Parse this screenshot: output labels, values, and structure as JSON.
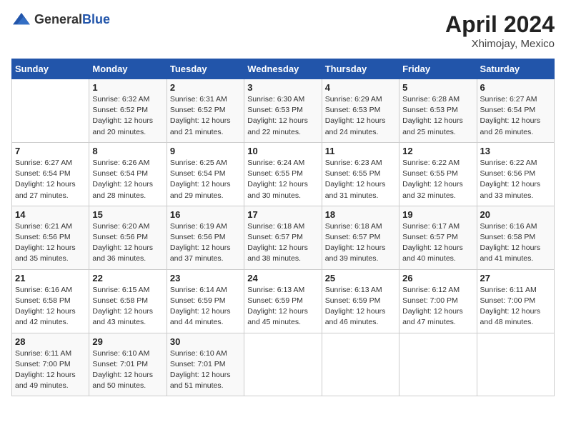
{
  "header": {
    "logo_general": "General",
    "logo_blue": "Blue",
    "month_year": "April 2024",
    "location": "Xhimojay, Mexico"
  },
  "days_of_week": [
    "Sunday",
    "Monday",
    "Tuesday",
    "Wednesday",
    "Thursday",
    "Friday",
    "Saturday"
  ],
  "weeks": [
    [
      {
        "day": "",
        "info": ""
      },
      {
        "day": "1",
        "info": "Sunrise: 6:32 AM\nSunset: 6:52 PM\nDaylight: 12 hours\nand 20 minutes."
      },
      {
        "day": "2",
        "info": "Sunrise: 6:31 AM\nSunset: 6:52 PM\nDaylight: 12 hours\nand 21 minutes."
      },
      {
        "day": "3",
        "info": "Sunrise: 6:30 AM\nSunset: 6:53 PM\nDaylight: 12 hours\nand 22 minutes."
      },
      {
        "day": "4",
        "info": "Sunrise: 6:29 AM\nSunset: 6:53 PM\nDaylight: 12 hours\nand 24 minutes."
      },
      {
        "day": "5",
        "info": "Sunrise: 6:28 AM\nSunset: 6:53 PM\nDaylight: 12 hours\nand 25 minutes."
      },
      {
        "day": "6",
        "info": "Sunrise: 6:27 AM\nSunset: 6:54 PM\nDaylight: 12 hours\nand 26 minutes."
      }
    ],
    [
      {
        "day": "7",
        "info": "Sunrise: 6:27 AM\nSunset: 6:54 PM\nDaylight: 12 hours\nand 27 minutes."
      },
      {
        "day": "8",
        "info": "Sunrise: 6:26 AM\nSunset: 6:54 PM\nDaylight: 12 hours\nand 28 minutes."
      },
      {
        "day": "9",
        "info": "Sunrise: 6:25 AM\nSunset: 6:54 PM\nDaylight: 12 hours\nand 29 minutes."
      },
      {
        "day": "10",
        "info": "Sunrise: 6:24 AM\nSunset: 6:55 PM\nDaylight: 12 hours\nand 30 minutes."
      },
      {
        "day": "11",
        "info": "Sunrise: 6:23 AM\nSunset: 6:55 PM\nDaylight: 12 hours\nand 31 minutes."
      },
      {
        "day": "12",
        "info": "Sunrise: 6:22 AM\nSunset: 6:55 PM\nDaylight: 12 hours\nand 32 minutes."
      },
      {
        "day": "13",
        "info": "Sunrise: 6:22 AM\nSunset: 6:56 PM\nDaylight: 12 hours\nand 33 minutes."
      }
    ],
    [
      {
        "day": "14",
        "info": "Sunrise: 6:21 AM\nSunset: 6:56 PM\nDaylight: 12 hours\nand 35 minutes."
      },
      {
        "day": "15",
        "info": "Sunrise: 6:20 AM\nSunset: 6:56 PM\nDaylight: 12 hours\nand 36 minutes."
      },
      {
        "day": "16",
        "info": "Sunrise: 6:19 AM\nSunset: 6:56 PM\nDaylight: 12 hours\nand 37 minutes."
      },
      {
        "day": "17",
        "info": "Sunrise: 6:18 AM\nSunset: 6:57 PM\nDaylight: 12 hours\nand 38 minutes."
      },
      {
        "day": "18",
        "info": "Sunrise: 6:18 AM\nSunset: 6:57 PM\nDaylight: 12 hours\nand 39 minutes."
      },
      {
        "day": "19",
        "info": "Sunrise: 6:17 AM\nSunset: 6:57 PM\nDaylight: 12 hours\nand 40 minutes."
      },
      {
        "day": "20",
        "info": "Sunrise: 6:16 AM\nSunset: 6:58 PM\nDaylight: 12 hours\nand 41 minutes."
      }
    ],
    [
      {
        "day": "21",
        "info": "Sunrise: 6:16 AM\nSunset: 6:58 PM\nDaylight: 12 hours\nand 42 minutes."
      },
      {
        "day": "22",
        "info": "Sunrise: 6:15 AM\nSunset: 6:58 PM\nDaylight: 12 hours\nand 43 minutes."
      },
      {
        "day": "23",
        "info": "Sunrise: 6:14 AM\nSunset: 6:59 PM\nDaylight: 12 hours\nand 44 minutes."
      },
      {
        "day": "24",
        "info": "Sunrise: 6:13 AM\nSunset: 6:59 PM\nDaylight: 12 hours\nand 45 minutes."
      },
      {
        "day": "25",
        "info": "Sunrise: 6:13 AM\nSunset: 6:59 PM\nDaylight: 12 hours\nand 46 minutes."
      },
      {
        "day": "26",
        "info": "Sunrise: 6:12 AM\nSunset: 7:00 PM\nDaylight: 12 hours\nand 47 minutes."
      },
      {
        "day": "27",
        "info": "Sunrise: 6:11 AM\nSunset: 7:00 PM\nDaylight: 12 hours\nand 48 minutes."
      }
    ],
    [
      {
        "day": "28",
        "info": "Sunrise: 6:11 AM\nSunset: 7:00 PM\nDaylight: 12 hours\nand 49 minutes."
      },
      {
        "day": "29",
        "info": "Sunrise: 6:10 AM\nSunset: 7:01 PM\nDaylight: 12 hours\nand 50 minutes."
      },
      {
        "day": "30",
        "info": "Sunrise: 6:10 AM\nSunset: 7:01 PM\nDaylight: 12 hours\nand 51 minutes."
      },
      {
        "day": "",
        "info": ""
      },
      {
        "day": "",
        "info": ""
      },
      {
        "day": "",
        "info": ""
      },
      {
        "day": "",
        "info": ""
      }
    ]
  ]
}
